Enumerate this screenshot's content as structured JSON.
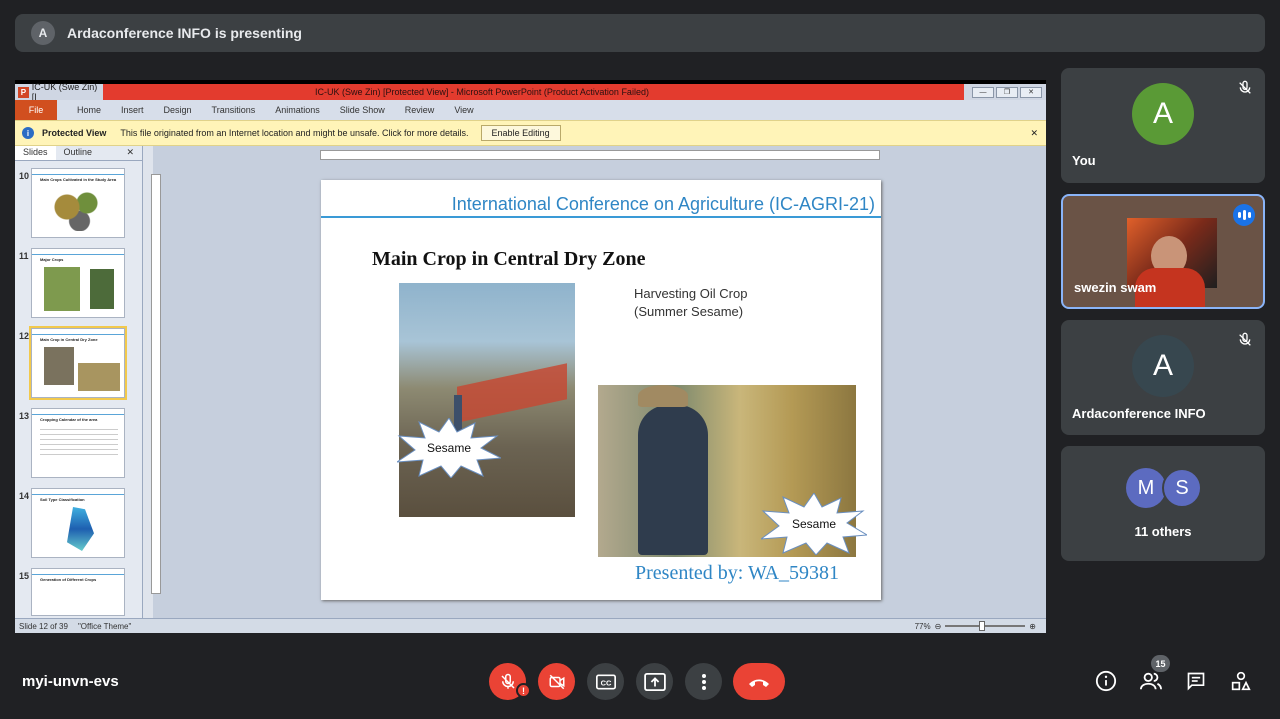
{
  "presenting_bar": {
    "avatar_letter": "A",
    "text": "Ardaconference INFO is presenting"
  },
  "powerpoint": {
    "window_left_title": "IC-UK (Swe Zin) [I",
    "window_title": "IC-UK (Swe Zin) [Protected View] - Microsoft PowerPoint (Product Activation Failed)",
    "ribbon_tabs": [
      "File",
      "Home",
      "Insert",
      "Design",
      "Transitions",
      "Animations",
      "Slide Show",
      "Review",
      "View"
    ],
    "protected_view": {
      "label": "Protected View",
      "message": "This file originated from an Internet location and might be unsafe. Click for more details.",
      "button": "Enable Editing"
    },
    "panel_tabs": [
      "Slides",
      "Outline"
    ],
    "thumbnails": [
      {
        "num": "10",
        "title": "Main Crops Cultivated in the Study Area"
      },
      {
        "num": "11",
        "title": "Major Crops"
      },
      {
        "num": "12",
        "title": "Main Crop in Central Dry Zone"
      },
      {
        "num": "13",
        "title": "Cropping Calendar of the area"
      },
      {
        "num": "14",
        "title": "Soil Type Classification"
      },
      {
        "num": "15",
        "title": "Generation of Different Crops"
      }
    ],
    "slide": {
      "conference": "International Conference on Agriculture (IC-AGRI-21)",
      "title": "Main Crop in Central Dry Zone",
      "caption_line1": "Harvesting Oil Crop",
      "caption_line2": "(Summer Sesame)",
      "label1": "Sesame",
      "label2": "Sesame",
      "presented_by": "Presented by:   WA_59381"
    },
    "status": {
      "slide_of": "Slide 12 of 39",
      "theme": "\"Office Theme\"",
      "zoom": "77%"
    }
  },
  "participants": {
    "you": {
      "letter": "A",
      "name": "You",
      "color": "#5a9a36"
    },
    "video": {
      "name": "swezin swam"
    },
    "host": {
      "letter": "A",
      "name": "Ardaconference INFO",
      "color": "#37474f"
    },
    "others": {
      "letters": [
        "M",
        "S"
      ],
      "colors": [
        "#5c6bc0",
        "#5c6bc0"
      ],
      "label": "11 others"
    }
  },
  "bottom": {
    "meeting_code": "myi-unvn-evs",
    "people_count": "15"
  }
}
